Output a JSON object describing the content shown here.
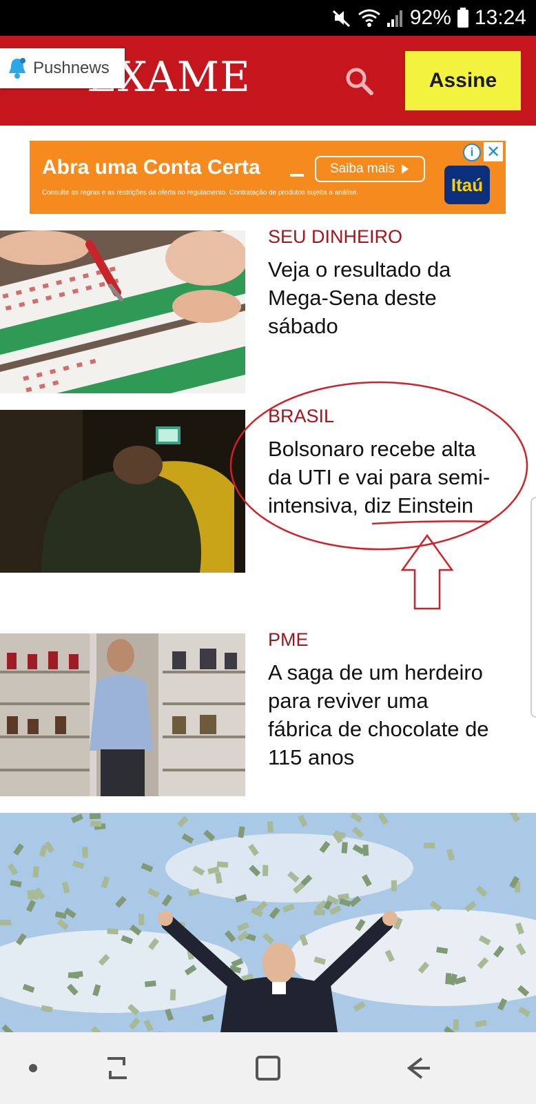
{
  "status_bar": {
    "icons": [
      "mute-icon",
      "wifi-icon",
      "cell-signal-icon",
      "battery-icon"
    ],
    "battery": "92%",
    "time": "13:24"
  },
  "header": {
    "logo": "EXAME",
    "search_icon": "search-icon",
    "subscribe_label": "Assine",
    "brand_color": "#c4161c",
    "subscribe_color": "#f3f33f"
  },
  "pushnews": {
    "icon": "bell-icon",
    "label": "Pushnews"
  },
  "ad": {
    "headline": "Abra uma Conta Certa",
    "cta": "Saiba mais",
    "fine_print": "Consulte as regras e as restrições da oferta no regulamento. Contratação de produtos sujeita a análise.",
    "brand": "Itaú",
    "info_icon": "info-icon",
    "close_icon": "close-icon"
  },
  "articles": [
    {
      "category": "SEU DINHEIRO",
      "headline_lines": [
        "Veja o resultado da",
        "Mega-Sena deste",
        "sábado"
      ],
      "image": "lottery-ticket-photo"
    },
    {
      "category": "BRASIL",
      "headline_lines": [
        "Bolsonaro recebe alta",
        "da UTI e vai para semi-",
        "intensiva, diz Einstein"
      ],
      "image": "hospital-bed-photo"
    },
    {
      "category": "PME",
      "headline_lines": [
        "A saga de um herdeiro",
        "para reviver uma",
        "fábrica de chocolate de",
        "115 anos"
      ],
      "image": "chocolate-shop-photo"
    }
  ],
  "hero": {
    "image": "money-rain-photo"
  },
  "annotation": {
    "color": "#d32026",
    "shapes": [
      "ellipse",
      "underline",
      "up-arrow"
    ]
  },
  "nav_bar": {
    "buttons": [
      "dot-icon",
      "recent-apps-icon",
      "home-icon",
      "back-icon"
    ]
  }
}
